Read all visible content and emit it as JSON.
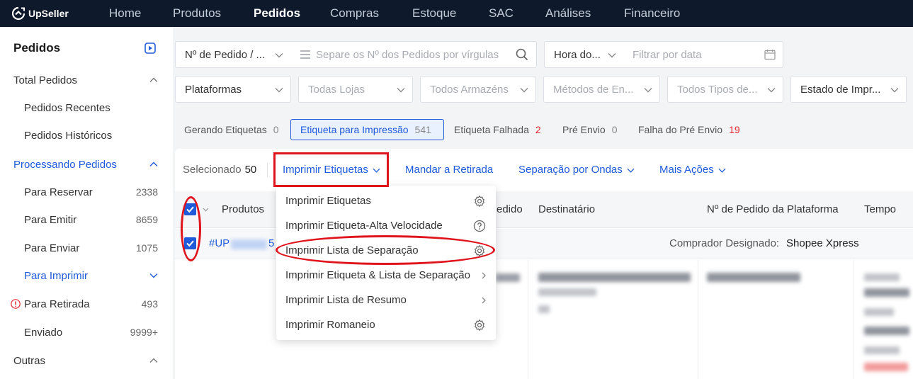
{
  "app": {
    "logo_text": "UpSeller",
    "logo_icon": "upseller-logo-icon"
  },
  "topnav": {
    "items": [
      "Home",
      "Produtos",
      "Pedidos",
      "Compras",
      "Estoque",
      "SAC",
      "Análises",
      "Financeiro"
    ],
    "active_index": 2
  },
  "sidebar": {
    "title": "Pedidos",
    "title_icon": "play-square-icon",
    "items": [
      {
        "label": "Total Pedidos",
        "expanded": true
      },
      {
        "label": "Pedidos Recentes"
      },
      {
        "label": "Pedidos Históricos"
      },
      {
        "label": "Processando Pedidos",
        "expanded": true,
        "active": true
      },
      {
        "label": "Para Reservar",
        "count": "2338"
      },
      {
        "label": "Para Emitir",
        "count": "8659"
      },
      {
        "label": "Para Enviar",
        "count": "1075"
      },
      {
        "label": "Para Imprimir",
        "active": true,
        "expanded": false
      },
      {
        "label": "Para Retirada",
        "count": "493",
        "alert_icon": "info-circle-icon"
      },
      {
        "label": "Enviado",
        "count": "9999+"
      },
      {
        "label": "Outras",
        "expanded": true
      }
    ]
  },
  "filters": {
    "row1": {
      "order_field": "Nº de Pedido / ...",
      "order_input_placeholder": "Separe os Nº dos Pedidos por vírgulas",
      "time_field": "Hora do...",
      "date_placeholder": "Filtrar por data"
    },
    "row2": [
      "Plataformas",
      "Todas Lojas",
      "Todos Armazéns",
      "Métodos de En...",
      "Todos Tipos de...",
      "Estado de Impr..."
    ]
  },
  "status_tabs": [
    {
      "label": "Gerando Etiquetas",
      "count": "0"
    },
    {
      "label": "Etiqueta para Impressão",
      "count": "541",
      "active": true
    },
    {
      "label": "Etiqueta Falhada",
      "count": "2",
      "count_color": "#e5252d"
    },
    {
      "label": "Pré Envio",
      "count": "0"
    },
    {
      "label": "Falha do Pré Envio",
      "count": "19",
      "count_color": "#e5252d"
    }
  ],
  "actions": {
    "selected_label": "Selecionado",
    "selected_count": "50",
    "buttons": [
      "Imprimir Etiquetas",
      "Mandar a Retirada",
      "Separação por Ondas",
      "Mais Ações"
    ]
  },
  "table": {
    "columns": [
      "Produtos",
      "edido",
      "Destinatário",
      "Nº de Pedido da Plataforma",
      "Tempo"
    ],
    "select_all_checked": true,
    "order": {
      "checked": true,
      "id_prefix": "#UP",
      "id_suffix": "5",
      "carrier_label": "Comprador Designado:",
      "carrier_value": "Shopee Xpress"
    }
  },
  "print_menu": {
    "items": [
      {
        "label": "Imprimir Etiquetas",
        "icon": "gear-icon"
      },
      {
        "label": "Imprimir Etiqueta-Alta Velocidade",
        "icon": "question-circle-icon"
      },
      {
        "label": "Imprimir Lista de Separação",
        "icon": "gear-icon",
        "highlighted": true
      },
      {
        "label": "Imprimir Etiqueta & Lista de Separação",
        "icon": "chevron-right-icon"
      },
      {
        "label": "Imprimir Lista de Resumo",
        "icon": "chevron-right-icon"
      },
      {
        "label": "Imprimir Romaneio",
        "icon": "gear-icon"
      }
    ]
  },
  "colors": {
    "nav_bg": "#0e1a2b",
    "accent": "#1f5bd9",
    "annotation_red": "#e0141c",
    "alert_red": "#e5252d"
  }
}
